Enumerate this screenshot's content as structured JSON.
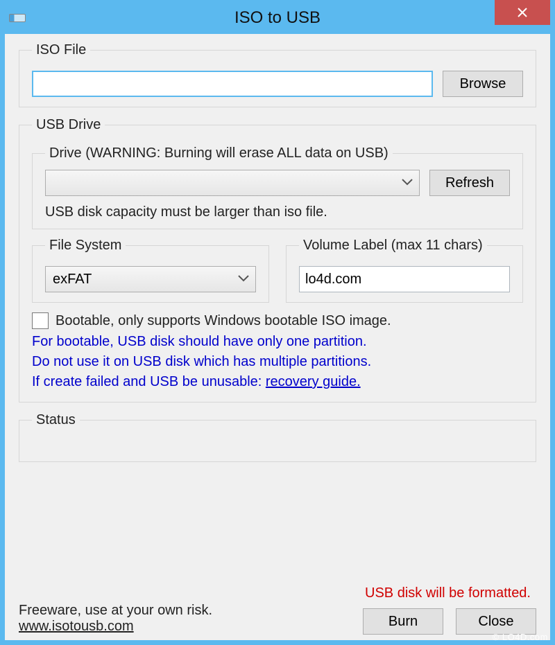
{
  "window": {
    "title": "ISO to USB"
  },
  "iso": {
    "legend": "ISO File",
    "path": "",
    "browse": "Browse"
  },
  "usb": {
    "legend": "USB Drive",
    "drive_legend": "Drive (WARNING: Burning will erase ALL data on USB)",
    "refresh": "Refresh",
    "capacity_note": "USB disk capacity must be larger than iso file.",
    "fs_legend": "File System",
    "fs_value": "exFAT",
    "vol_legend": "Volume Label (max 11 chars)",
    "vol_value": "lo4d.com",
    "bootable_label": "Bootable, only supports Windows bootable ISO image.",
    "blue_line1": "For bootable, USB disk should have only one partition.",
    "blue_line2": "Do not use it on USB disk which has multiple partitions.",
    "blue_line3a": "If create failed and USB be unusable: ",
    "blue_link": "recovery guide."
  },
  "status": {
    "legend": "Status"
  },
  "footer": {
    "freeware": "Freeware, use at your own risk.",
    "site": "www.isotousb.com",
    "format_warn": "USB disk will be formatted.",
    "burn": "Burn",
    "close": "Close"
  },
  "watermark": "© LO4D.com"
}
